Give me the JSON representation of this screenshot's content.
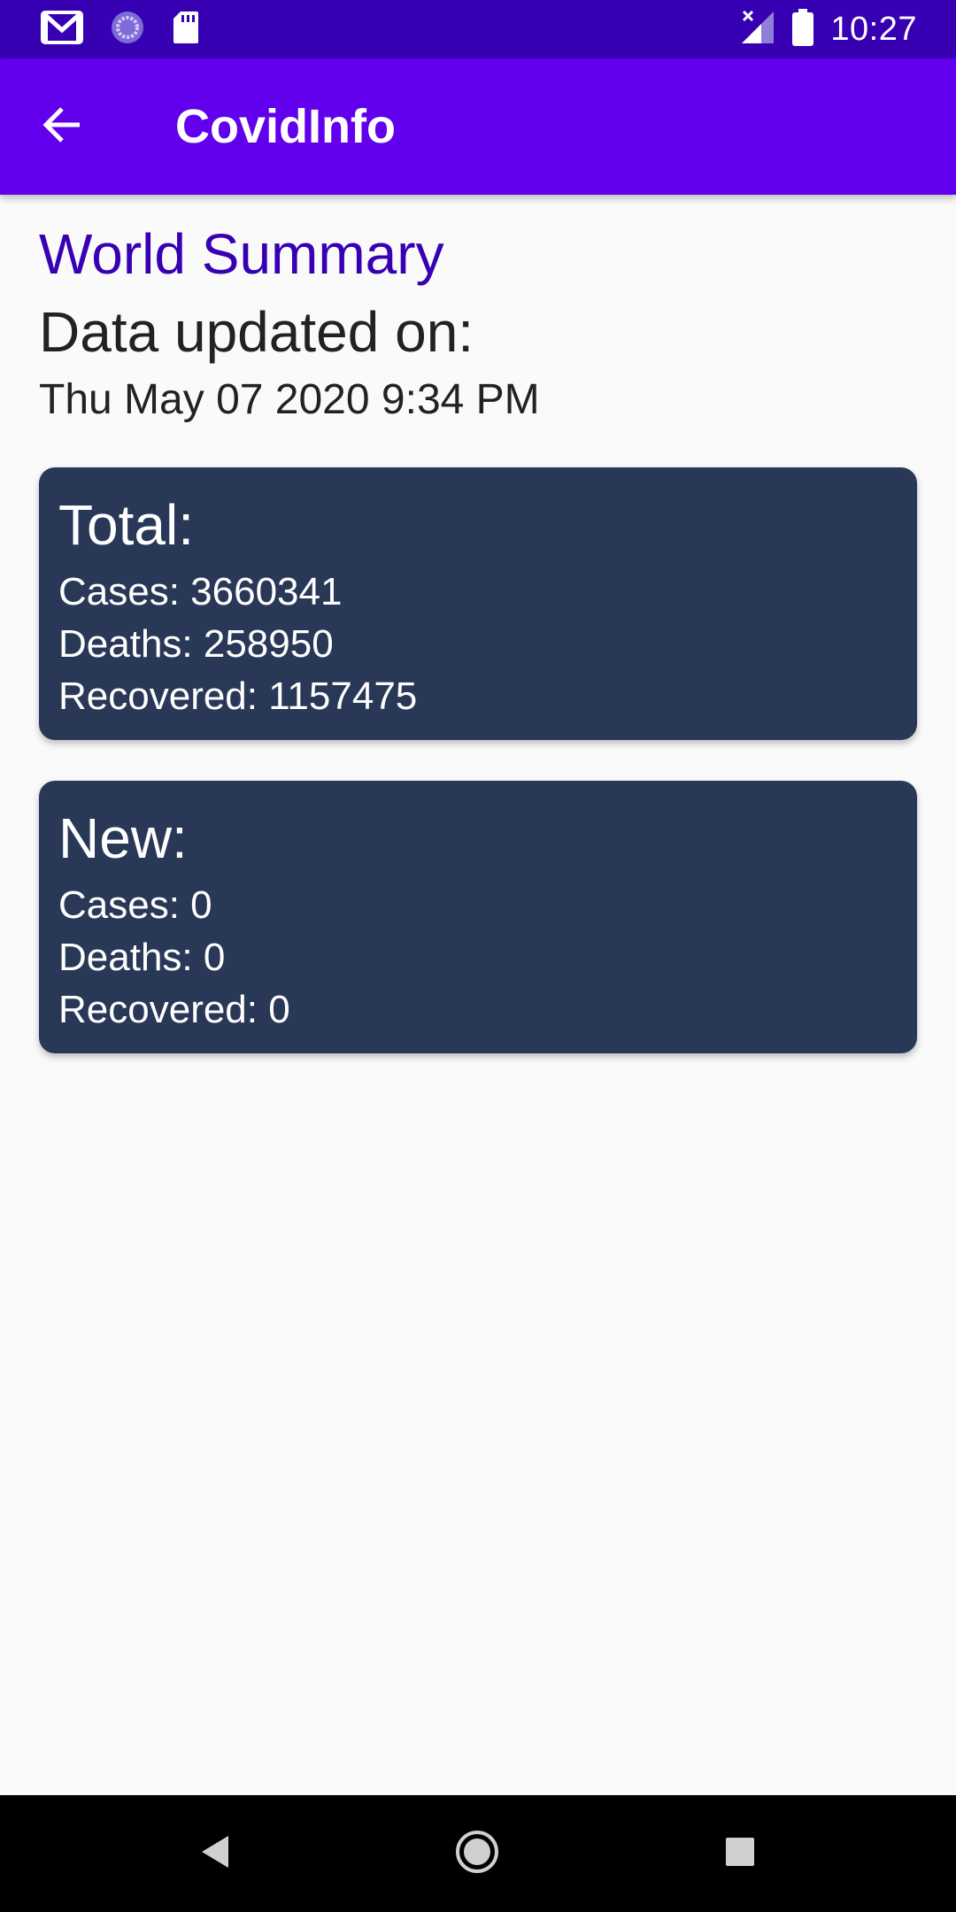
{
  "status_bar": {
    "time": "10:27",
    "icons": [
      "gmail-icon",
      "sync-icon",
      "sd-card-icon",
      "no-signal-icon",
      "battery-icon"
    ]
  },
  "app_bar": {
    "title": "CovidInfo",
    "back_icon": "arrow-back-icon",
    "color": "#6200ee"
  },
  "summary": {
    "title": "World Summary",
    "updated_label": "Data updated on:",
    "updated_date": "Thu May 07 2020 9:34 PM"
  },
  "cards": {
    "total": {
      "heading": "Total:",
      "cases": "Cases: 3660341",
      "deaths": "Deaths: 258950",
      "recovered": "Recovered: 1157475"
    },
    "new": {
      "heading": "New:",
      "cases": "Cases: 0",
      "deaths": "Deaths: 0",
      "recovered": "Recovered: 0"
    }
  },
  "nav_bar": {
    "icons": [
      "nav-back-icon",
      "nav-home-icon",
      "nav-recents-icon"
    ]
  },
  "colors": {
    "status_bar": "#3700b3",
    "app_bar": "#6200ee",
    "card_background": "#283856",
    "title_accent": "#3700b3"
  }
}
